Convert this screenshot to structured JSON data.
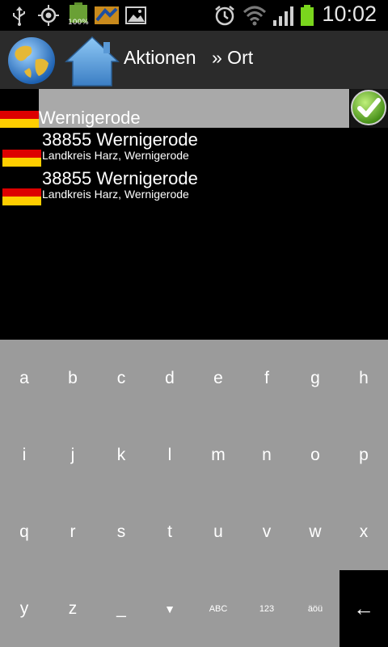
{
  "status_bar": {
    "time": "10:02",
    "battery_badge": "100%",
    "icons": [
      "usb-icon",
      "gps-icon",
      "battery-app-icon",
      "app-icon",
      "gallery-icon",
      "alarm-icon",
      "wifi-icon",
      "signal-icon",
      "battery-icon"
    ]
  },
  "action_bar": {
    "title": "Aktionen",
    "breadcrumb": "» Ort"
  },
  "search": {
    "value": "Wernigerode",
    "country": "Germany"
  },
  "results": [
    {
      "title": "38855 Wernigerode",
      "subtitle": "Landkreis Harz, Wernigerode"
    },
    {
      "title": "38855 Wernigerode",
      "subtitle": "Landkreis Harz, Wernigerode"
    }
  ],
  "keyboard": {
    "row1": [
      "a",
      "b",
      "c",
      "d",
      "e",
      "f",
      "g",
      "h"
    ],
    "row2": [
      "i",
      "j",
      "k",
      "l",
      "m",
      "n",
      "o",
      "p"
    ],
    "row3": [
      "q",
      "r",
      "s",
      "t",
      "u",
      "v",
      "w",
      "x"
    ],
    "row4": [
      "y",
      "z",
      "_",
      "▼",
      "ABC",
      "123",
      "äöü",
      "←"
    ]
  },
  "colors": {
    "flag_black": "#000000",
    "flag_red": "#dd0000",
    "flag_gold": "#ffce00",
    "keyboard_bg": "#9b9b9b",
    "search_bg": "#a9a9a9"
  }
}
